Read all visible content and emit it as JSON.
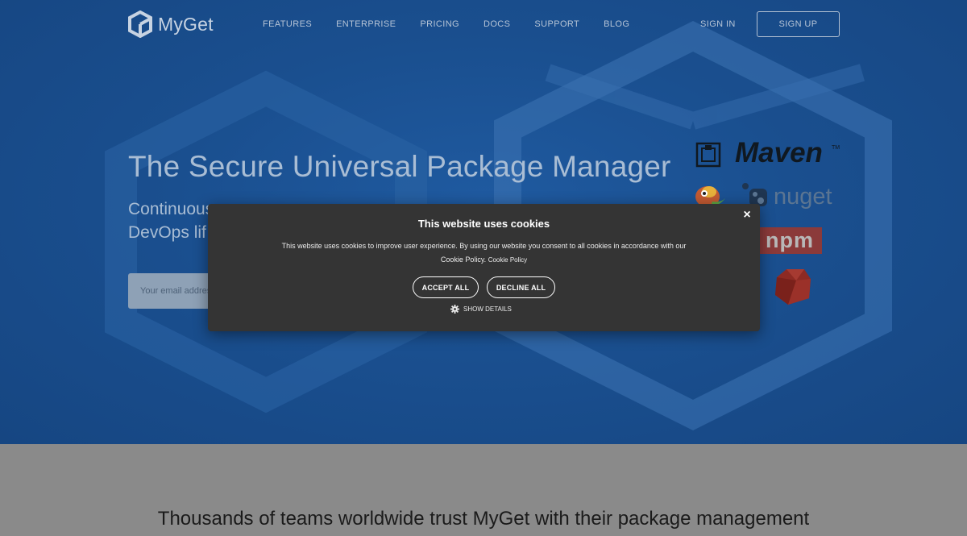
{
  "brand": {
    "name": "MyGet"
  },
  "nav": {
    "links": [
      "FEATURES",
      "ENTERPRISE",
      "PRICING",
      "DOCS",
      "SUPPORT",
      "BLOG"
    ],
    "sign_in": "SIGN IN",
    "sign_up": "SIGN UP"
  },
  "hero": {
    "headline": "The Secure Universal Package Manager",
    "subline_1": "Continuous",
    "subline_2": "DevOps lif",
    "email_placeholder": "Your email address",
    "logos": {
      "maven": "Maven",
      "maven_tm": "TM",
      "nuget": "nuget",
      "npm": "npm"
    }
  },
  "section": {
    "trust_text": "Thousands of teams worldwide trust MyGet with their package management"
  },
  "cookie_modal": {
    "title": "This website uses cookies",
    "body": "This website uses cookies to improve user experience. By using our website you consent to all cookies in accordance with our Cookie Policy.",
    "policy_link": "Cookie Policy",
    "accept": "ACCEPT ALL",
    "decline": "DECLINE ALL",
    "details": "SHOW DETAILS",
    "close_symbol": "×"
  },
  "colors": {
    "hero_blue": "#1a4f8f",
    "modal_bg": "#343434",
    "lower_bg": "#8a8a8a"
  }
}
